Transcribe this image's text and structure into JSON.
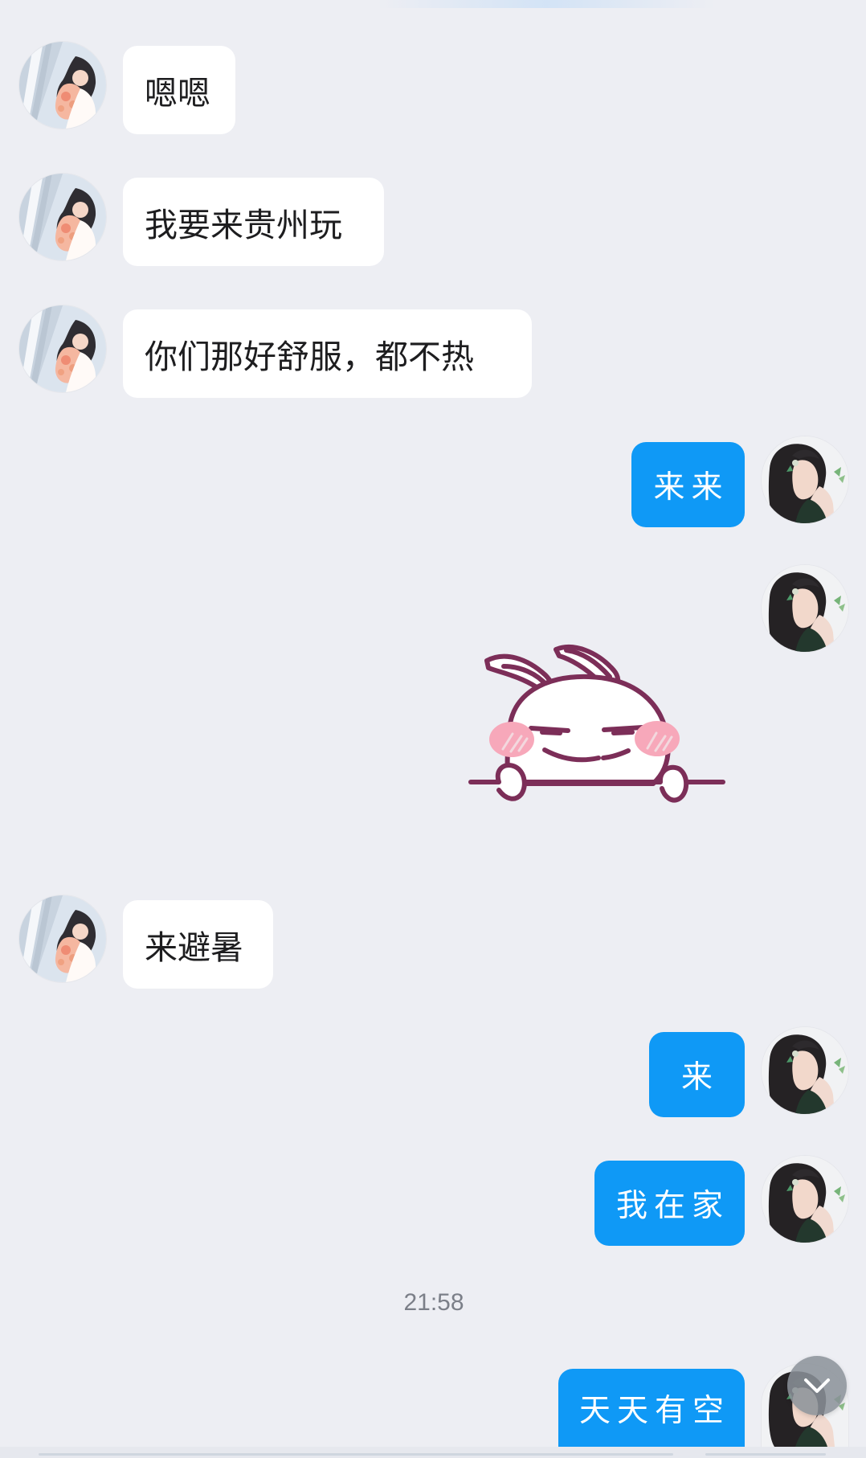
{
  "messages": {
    "m1": {
      "text": "嗯嗯"
    },
    "m2": {
      "text": "我要来贵州玩"
    },
    "m3": {
      "text": "你们那好舒服，都不热"
    },
    "m4": {
      "text": "来来"
    },
    "m5": {
      "text": "来避暑"
    },
    "m6": {
      "text": "来"
    },
    "m7": {
      "text": "我在家"
    },
    "m8": {
      "text": "天天有空"
    }
  },
  "timestamp": "21:58",
  "icons": {
    "scroll_down": "chevron-down-icon",
    "sticker": "rabbit-sticker"
  },
  "colors": {
    "background": "#edeef3",
    "incoming_bubble": "#ffffff",
    "outgoing_bubble": "#0f99f6",
    "timestamp_text": "#7b7f88"
  }
}
